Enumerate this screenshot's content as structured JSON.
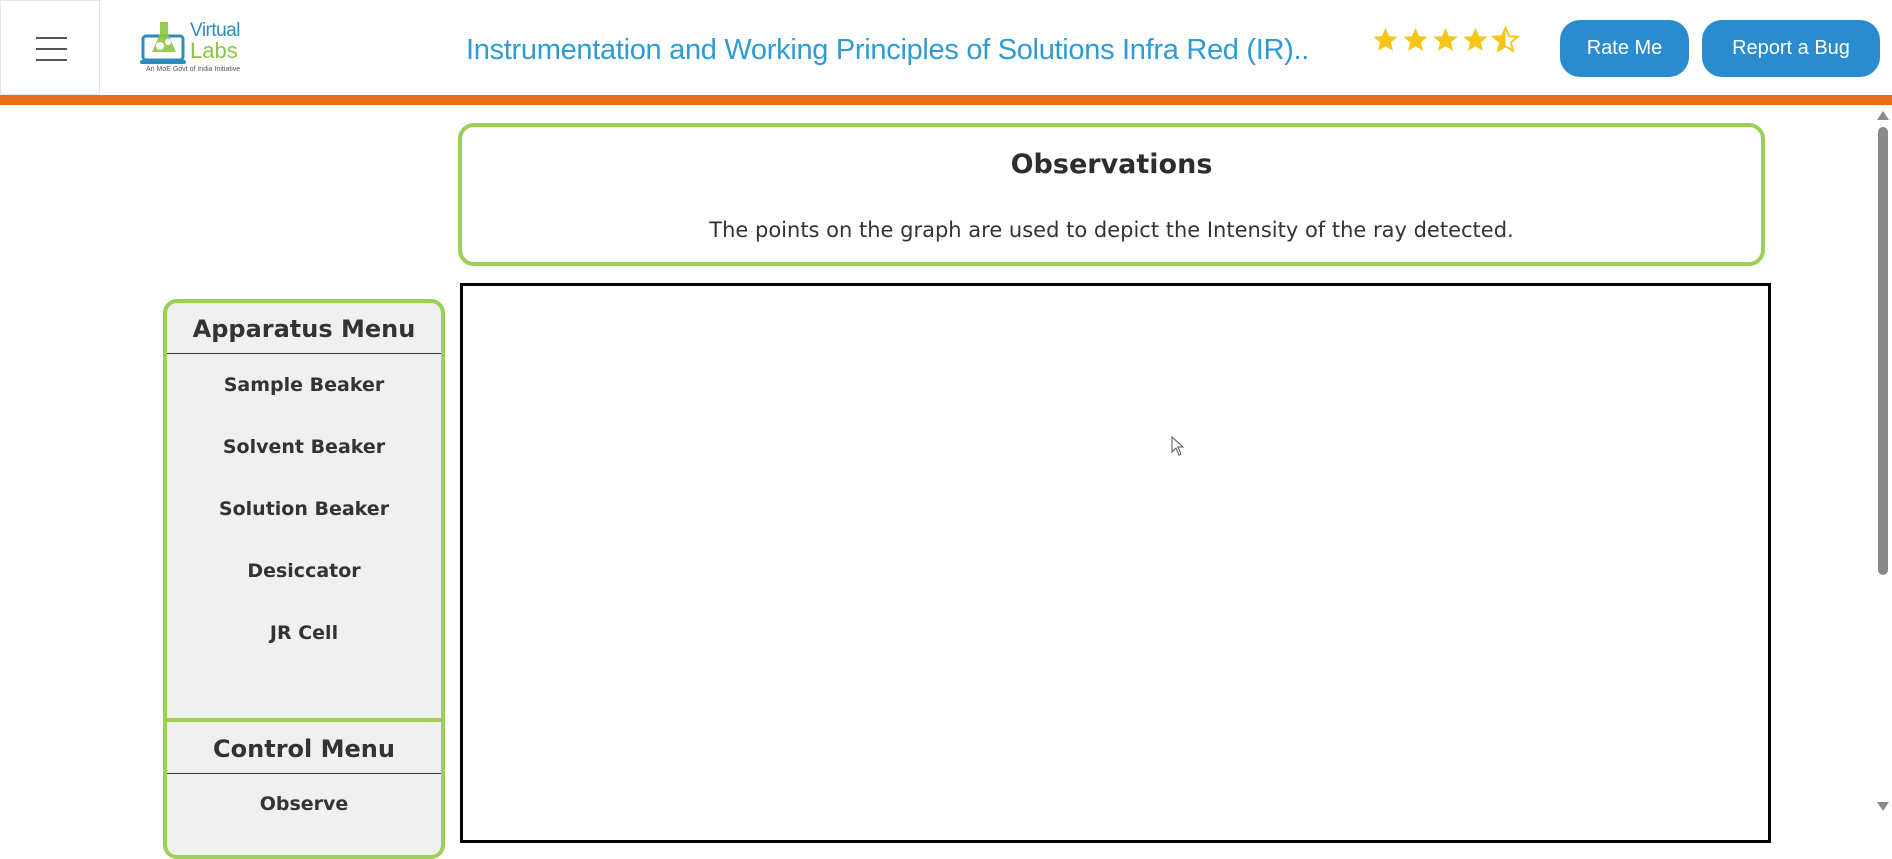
{
  "header": {
    "logo": {
      "line1": "Virtual",
      "line2": "Labs",
      "tagline": "An MoE Govt of India Initiative"
    },
    "title": "Instrumentation and Working Principles of Solutions Infra Red (IR)..",
    "rating": {
      "value": 4.5,
      "max": 5,
      "color": "#f5c518"
    },
    "rate_button_label": "Rate Me",
    "bug_button_label": "Report a Bug"
  },
  "colors": {
    "accent_orange": "#ec6e1c",
    "button_blue": "#2a8bcf",
    "border_green": "#9ccf55",
    "title_blue": "#2e9bd5"
  },
  "observations": {
    "title": "Observations",
    "text": "The points on the graph are used to depict the Intensity of the ray detected."
  },
  "sidebar": {
    "apparatus_heading": "Apparatus Menu",
    "apparatus_items": [
      {
        "label": "Sample Beaker"
      },
      {
        "label": "Solvent Beaker"
      },
      {
        "label": "Solution Beaker"
      },
      {
        "label": "Desiccator"
      },
      {
        "label": "JR Cell"
      }
    ],
    "control_heading": "Control Menu",
    "control_items": [
      {
        "label": "Observe"
      }
    ]
  },
  "icons": {
    "menu": "hamburger-icon",
    "star": "star-icon",
    "cursor": "mouse-pointer-icon"
  }
}
